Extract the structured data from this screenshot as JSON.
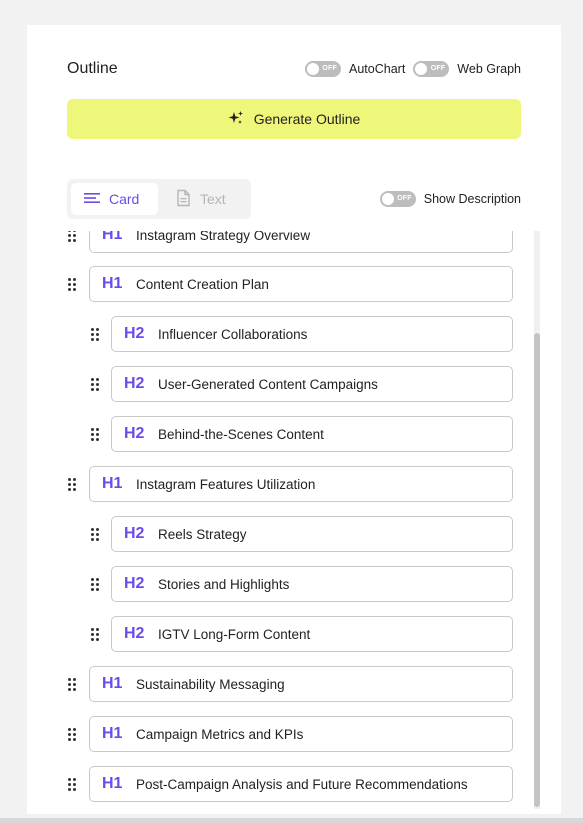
{
  "outline": {
    "title": "Outline",
    "autochart": {
      "label": "AutoChart",
      "state": "OFF"
    },
    "webgraph": {
      "label": "Web Graph",
      "state": "OFF"
    },
    "generate_label": "Generate Outline",
    "tabs": [
      {
        "label": "Card",
        "active": true,
        "icon": "list-icon"
      },
      {
        "label": "Text",
        "active": false,
        "icon": "document-icon"
      }
    ],
    "show_description": {
      "label": "Show Description",
      "state": "OFF"
    },
    "items": [
      {
        "level": "H1",
        "text": "Instagram Strategy Overview"
      },
      {
        "level": "H1",
        "text": "Content Creation Plan"
      },
      {
        "level": "H2",
        "text": "Influencer Collaborations"
      },
      {
        "level": "H2",
        "text": "User-Generated Content Campaigns"
      },
      {
        "level": "H2",
        "text": "Behind-the-Scenes Content"
      },
      {
        "level": "H1",
        "text": "Instagram Features Utilization"
      },
      {
        "level": "H2",
        "text": "Reels Strategy"
      },
      {
        "level": "H2",
        "text": "Stories and Highlights"
      },
      {
        "level": "H2",
        "text": "IGTV Long-Form Content"
      },
      {
        "level": "H1",
        "text": "Sustainability Messaging"
      },
      {
        "level": "H1",
        "text": "Campaign Metrics and KPIs"
      },
      {
        "level": "H1",
        "text": "Post-Campaign Analysis and Future Recommendations"
      }
    ]
  },
  "colors": {
    "accent": "#6d4aea",
    "button_bg": "#eff77a",
    "switch_off": "#bdbdbd"
  }
}
